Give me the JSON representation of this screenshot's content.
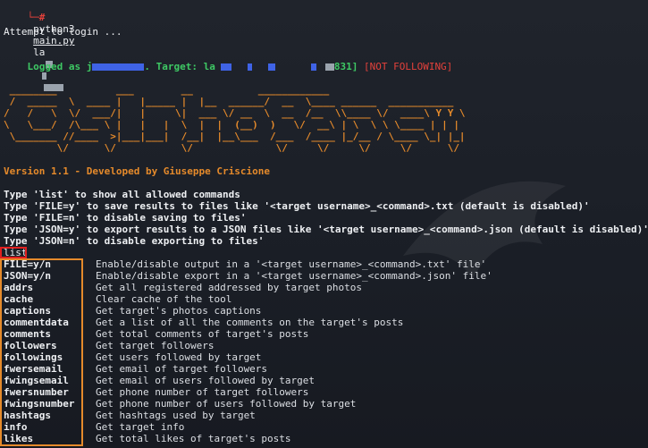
{
  "prompt": {
    "arrow": "└─#",
    "command": "python3",
    "script": "main.py",
    "arg": "la"
  },
  "attempt": "Attempt to login ...",
  "logged": {
    "prefix": "Logged as j",
    "mid": ". Target: la",
    "suffix": "831]",
    "status": "[NOT FOLLOWING]"
  },
  "version": "Version 1.1 - Developed by Giuseppe Criscione",
  "help_lines": [
    "Type 'list' to show all allowed commands",
    "Type 'FILE=y' to save results to files like '<target username>_<command>.txt (default is disabled)'",
    "Type 'FILE=n' to disable saving to files'",
    "Type 'JSON=y' to export results to a JSON files like '<target username>_<command>.json (default is disabled)'",
    "Type 'JSON=n' to disable exporting to files'"
  ],
  "input": "list",
  "commands": [
    {
      "name": "FILE=y/n",
      "desc": "Enable/disable output in a '<target username>_<command>.txt' file'"
    },
    {
      "name": "JSON=y/n",
      "desc": "Enable/disable export in a '<target username>_<command>.json' file'"
    },
    {
      "name": "addrs",
      "desc": "Get all registered addressed by target photos"
    },
    {
      "name": "cache",
      "desc": "Clear cache of the tool"
    },
    {
      "name": "captions",
      "desc": "Get target's photos captions"
    },
    {
      "name": "commentdata",
      "desc": "Get a list of all the comments on the target's posts"
    },
    {
      "name": "comments",
      "desc": "Get total comments of target's posts"
    },
    {
      "name": "followers",
      "desc": "Get target followers"
    },
    {
      "name": "followings",
      "desc": "Get users followed by target"
    },
    {
      "name": "fwersemail",
      "desc": "Get email of target followers"
    },
    {
      "name": "fwingsemail",
      "desc": "Get email of users followed by target"
    },
    {
      "name": "fwersnumber",
      "desc": "Get phone number of target followers"
    },
    {
      "name": "fwingsnumber",
      "desc": "Get phone number of users followed by target"
    },
    {
      "name": "hashtags",
      "desc": "Get hashtags used by target"
    },
    {
      "name": "info",
      "desc": "Get target info"
    },
    {
      "name": "likes",
      "desc": "Get total likes of target's posts"
    }
  ],
  "colors": {
    "background": "#1b1f27",
    "green": "#3ec964",
    "red": "#e4413b",
    "orange": "#e58a2b",
    "redaction": "#3f63e6"
  }
}
